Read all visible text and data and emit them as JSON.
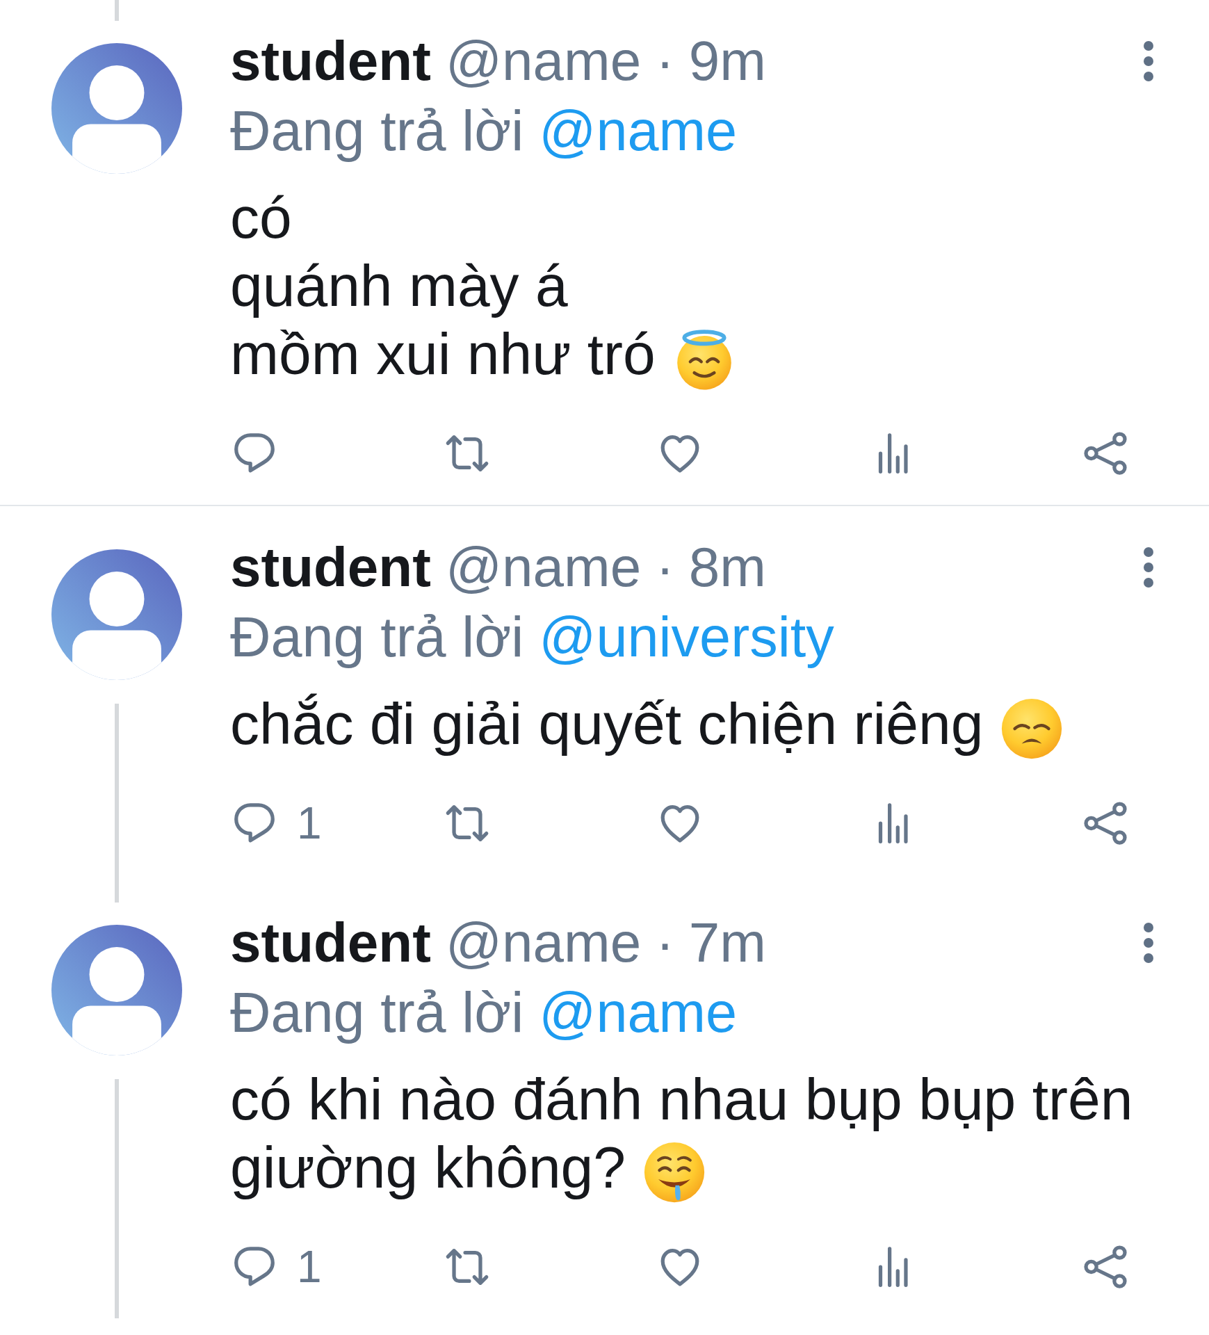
{
  "tweets": [
    {
      "author": "student",
      "handle": "@name",
      "separator": "·",
      "time": "9m",
      "reply_label": "Đang trả lời",
      "reply_to": "@name",
      "lines": [
        "có",
        "quánh mày á",
        "mồm xui như tró"
      ],
      "emoji": {
        "kind": "halo"
      },
      "thread_above": true,
      "thread_below": false,
      "actions": [
        {
          "kind": "reply"
        },
        {
          "kind": "repost"
        },
        {
          "kind": "like"
        },
        {
          "kind": "views"
        },
        {
          "kind": "share"
        }
      ]
    },
    {
      "author": "student",
      "handle": "@name",
      "separator": "·",
      "time": "8m",
      "reply_label": "Đang trả lời",
      "reply_to": "@university",
      "lines": [
        "chắc đi giải quyết chiện riêng"
      ],
      "emoji": {
        "kind": "disappointed"
      },
      "thread_above": false,
      "thread_below": true,
      "actions": [
        {
          "kind": "reply",
          "count": "1"
        },
        {
          "kind": "repost"
        },
        {
          "kind": "like"
        },
        {
          "kind": "views"
        },
        {
          "kind": "share"
        }
      ]
    },
    {
      "author": "student",
      "handle": "@name",
      "separator": "·",
      "time": "7m",
      "reply_label": "Đang trả lời",
      "reply_to": "@name",
      "lines": [
        "có khi nào đánh nhau bụp bụp trên",
        "giường không?"
      ],
      "emoji": {
        "kind": "drooling"
      },
      "thread_above": true,
      "thread_below": true,
      "actions": [
        {
          "kind": "reply",
          "count": "1"
        },
        {
          "kind": "repost"
        },
        {
          "kind": "like"
        },
        {
          "kind": "views"
        },
        {
          "kind": "share"
        }
      ]
    }
  ]
}
